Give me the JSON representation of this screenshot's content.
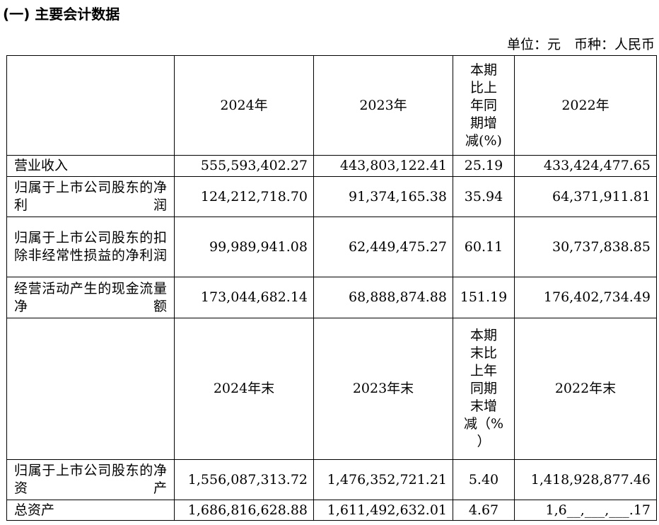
{
  "section_title": "(一) 主要会计数据",
  "unit_line": "单位：元　币种：人民币",
  "header1": {
    "col1": "2024年",
    "col2": "2023年",
    "change_lines": [
      "本期",
      "比上",
      "年同",
      "期增",
      "减(%)"
    ],
    "col4": "2022年"
  },
  "rows1": [
    {
      "label": "营业收入",
      "v2024": "555,593,402.27",
      "v2023": "443,803,122.41",
      "change": "25.19",
      "v2022": "433,424,477.65"
    },
    {
      "label": "归属于上市公司股东的净利润",
      "v2024": "124,212,718.70",
      "v2023": "91,374,165.38",
      "change": "35.94",
      "v2022": "64,371,911.81"
    },
    {
      "label": "归属于上市公司股东的扣除非经常性损益的净利润",
      "v2024": "99,989,941.08",
      "v2023": "62,449,475.27",
      "change": "60.11",
      "v2022": "30,737,838.85"
    },
    {
      "label": "经营活动产生的现金流量净额",
      "v2024": "173,044,682.14",
      "v2023": "68,888,874.88",
      "change": "151.19",
      "v2022": "176,402,734.49"
    }
  ],
  "header2": {
    "col1": "2024年末",
    "col2": "2023年末",
    "change_lines": [
      "本期",
      "末比",
      "上年",
      "同期",
      "末增",
      "减（%",
      "）"
    ],
    "col4": "2022年末"
  },
  "rows2": [
    {
      "label": "归属于上市公司股东的净资产",
      "v2024": "1,556,087,313.72",
      "v2023": "1,476,352,721.21",
      "change": "5.40",
      "v2022": "1,418,928,877.46"
    },
    {
      "label": "总资产",
      "v2024": "1,686,816,628.88",
      "v2023": "1,611,492,632.01",
      "change": "4.67",
      "v2022": "1,6__,___,___.17"
    }
  ]
}
